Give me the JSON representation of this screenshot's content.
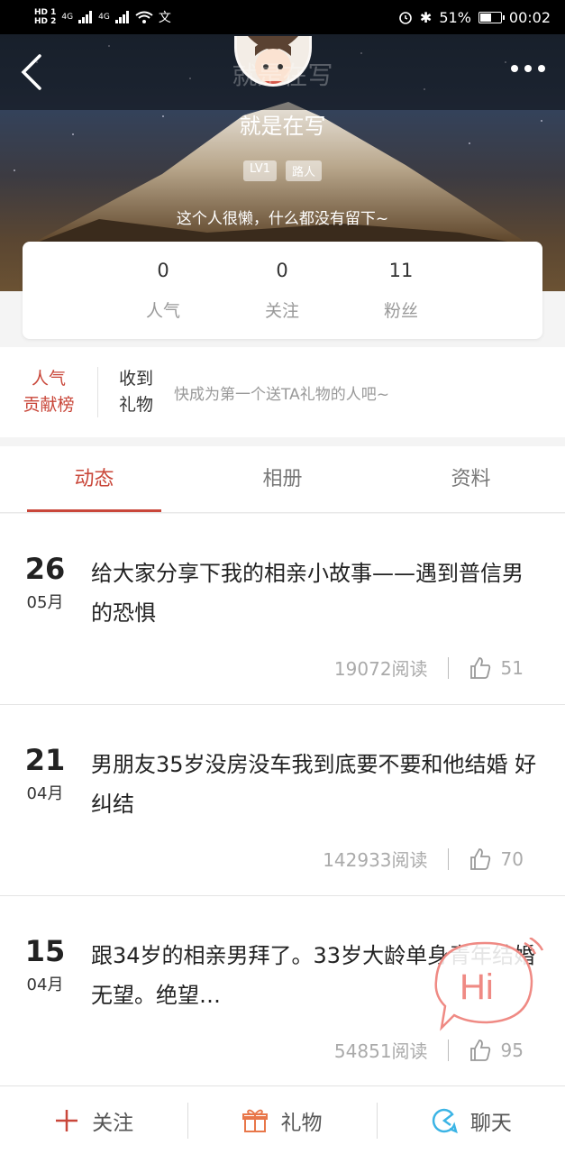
{
  "status_bar": {
    "time": "00:02",
    "battery": "51%",
    "network_top": "4G",
    "network_2": "4G",
    "hd1": "HD 1",
    "hd2": "HD 2"
  },
  "profile": {
    "ghost_name": "就是在写",
    "name": "就是在写",
    "level": "LV1",
    "role": "路人",
    "bio": "这个人很懒，什么都没有留下~"
  },
  "stats": [
    {
      "num": "0",
      "label": "人气"
    },
    {
      "num": "0",
      "label": "关注"
    },
    {
      "num": "11",
      "label": "粉丝"
    }
  ],
  "gifts": {
    "rank_line1": "人气",
    "rank_line2": "贡献榜",
    "received_line1": "收到",
    "received_line2": "礼物",
    "hint": "快成为第一个送TA礼物的人吧~"
  },
  "tabs": [
    "动态",
    "相册",
    "资料"
  ],
  "posts": [
    {
      "day": "26",
      "month": "05月",
      "title": "给大家分享下我的相亲小故事——遇到普信男的恐惧",
      "reads": "19072阅读",
      "likes": "51"
    },
    {
      "day": "21",
      "month": "04月",
      "title": "男朋友35岁没房没车我到底要不要和他结婚 好纠结",
      "reads": "142933阅读",
      "likes": "70"
    },
    {
      "day": "15",
      "month": "04月",
      "title": "跟34岁的相亲男拜了。33岁大龄单身青年结婚无望。绝望…",
      "reads": "54851阅读",
      "likes": "95"
    }
  ],
  "hi_label": "Hi",
  "bottom_bar": {
    "follow": "关注",
    "gift": "礼物",
    "chat": "聊天"
  },
  "colors": {
    "accent": "#c9473a",
    "chat": "#3bb4e5",
    "gift": "#e8774a"
  }
}
